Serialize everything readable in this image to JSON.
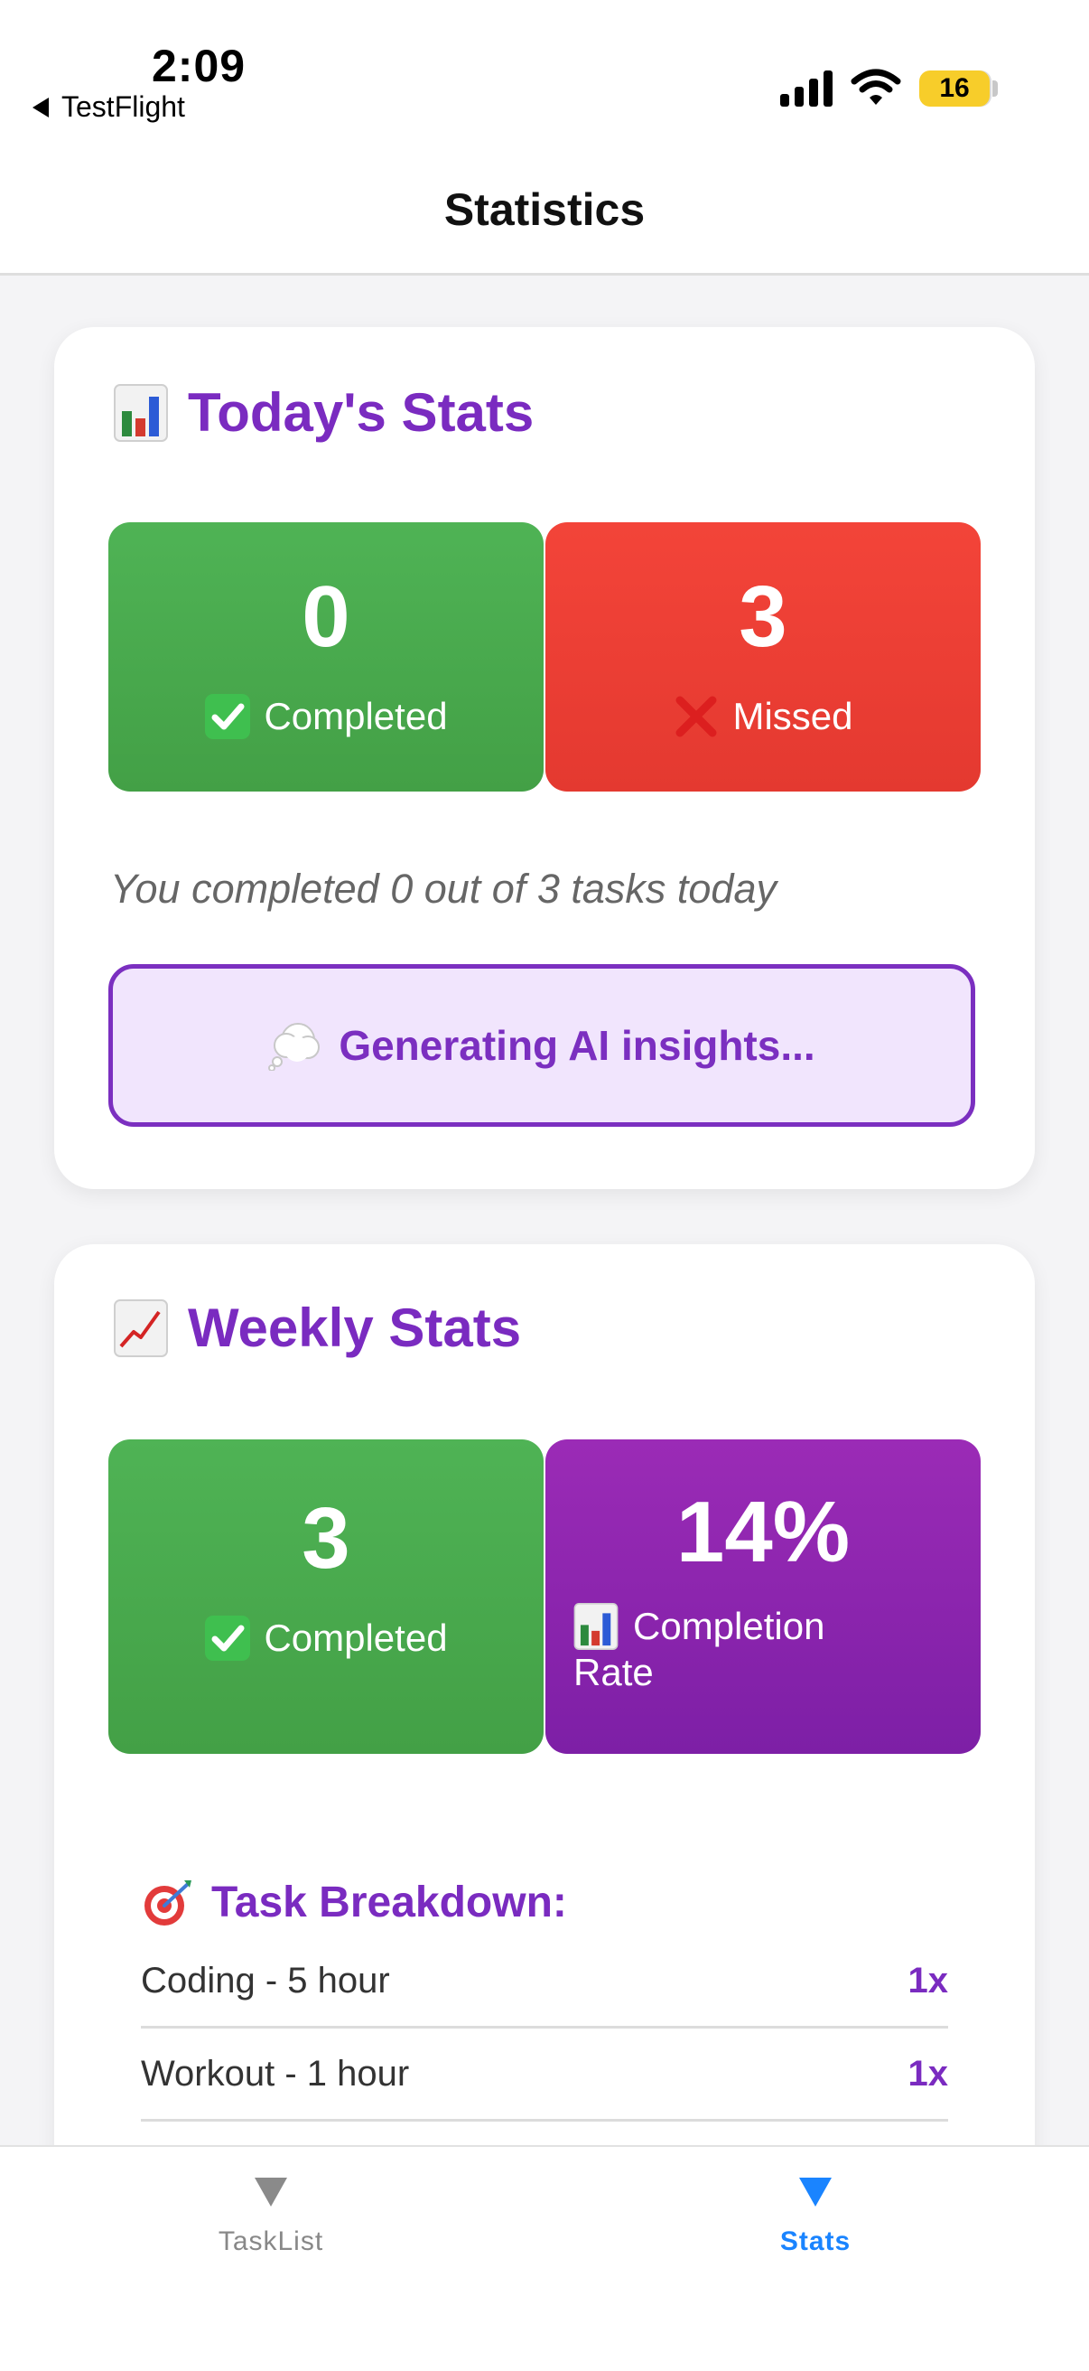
{
  "status_bar": {
    "time": "2:09",
    "back_label": "TestFlight",
    "battery_level": "16"
  },
  "header": {
    "title": "Statistics"
  },
  "today": {
    "title": "Today's Stats",
    "completed": {
      "value": "0",
      "label": "Completed"
    },
    "missed": {
      "value": "3",
      "label": "Missed"
    },
    "summary": "You completed 0 out of 3 tasks today",
    "ai_insights": "Generating AI insights..."
  },
  "weekly": {
    "title": "Weekly Stats",
    "completed": {
      "value": "3",
      "label": "Completed"
    },
    "completion_rate": {
      "value": "14%",
      "label_line1": "Completion",
      "label_line2": "Rate"
    },
    "breakdown": {
      "title": "Task Breakdown:",
      "items": [
        {
          "name": "Coding - 5 hour",
          "count": "1x"
        },
        {
          "name": "Workout - 1 hour",
          "count": "1x"
        }
      ]
    }
  },
  "tabs": [
    {
      "label": "TaskList",
      "active": false
    },
    {
      "label": "Stats",
      "active": true
    }
  ],
  "colors": {
    "accent_purple": "#7a2bc0",
    "success_green": "#43a046",
    "missed_red": "#e43930",
    "tab_active_blue": "#1a84ff"
  },
  "icons": {
    "today_title": "bar-chart-icon",
    "weekly_title": "chart-increasing-icon",
    "completed": "check-mark-button-icon",
    "missed": "cross-mark-icon",
    "ai": "thought-balloon-icon",
    "breakdown": "direct-hit-icon",
    "tab": "triangle-down-icon"
  }
}
